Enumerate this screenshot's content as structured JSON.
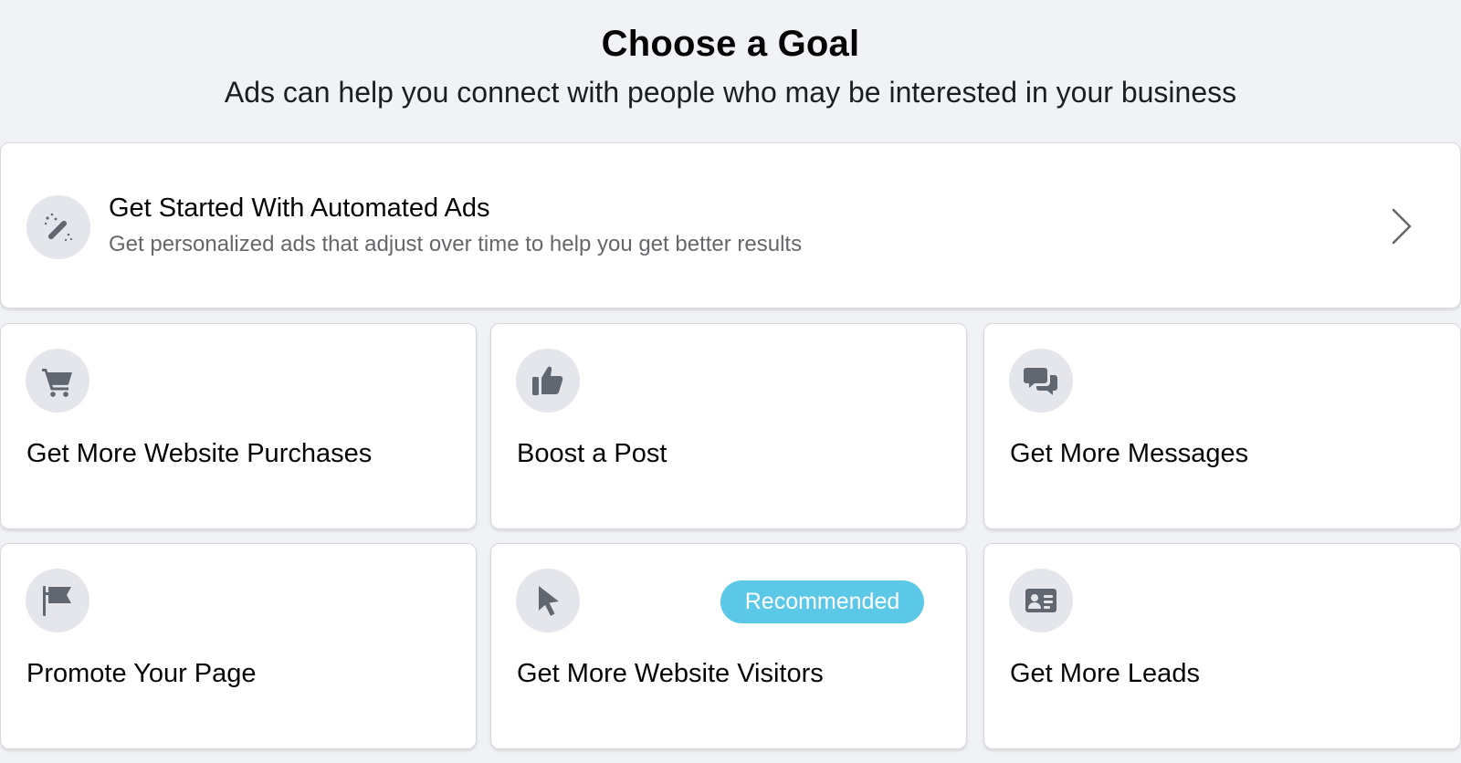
{
  "header": {
    "title": "Choose a Goal",
    "subtitle": "Ads can help you connect with people who may be interested in your business"
  },
  "automated": {
    "title": "Get Started With Automated Ads",
    "description": "Get personalized ads that adjust over time to help you get better results",
    "icon": "magic-wand-icon"
  },
  "goals": [
    {
      "label": "Get More Website Purchases",
      "icon": "shopping-cart-icon"
    },
    {
      "label": "Boost a Post",
      "icon": "thumbs-up-icon"
    },
    {
      "label": "Get More Messages",
      "icon": "chat-bubbles-icon"
    },
    {
      "label": "Promote Your Page",
      "icon": "flag-icon"
    },
    {
      "label": "Get More Website Visitors",
      "icon": "cursor-icon",
      "badge": "Recommended"
    },
    {
      "label": "Get More Leads",
      "icon": "contact-card-icon"
    }
  ],
  "colors": {
    "background": "#f0f2f5",
    "card": "#ffffff",
    "icon_circle": "#e4e6eb",
    "icon": "#606770",
    "badge": "#5bc8e8",
    "secondary_text": "#65676b"
  }
}
